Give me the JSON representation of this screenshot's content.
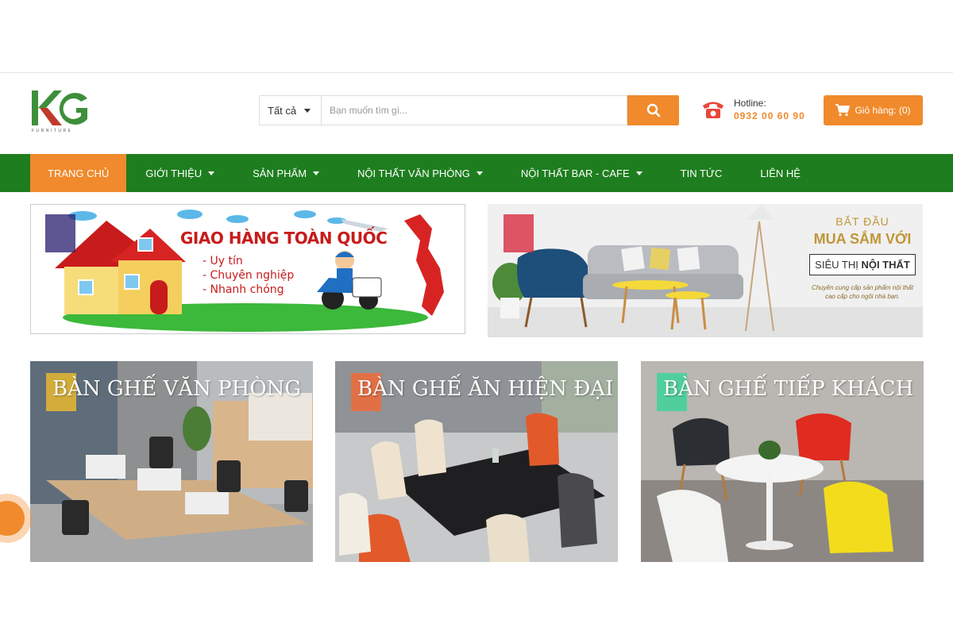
{
  "header": {
    "logo_text": "KG",
    "logo_tagline": "FURNITURE",
    "search": {
      "category": "Tất cả",
      "placeholder": "Bạn muốn tìm gì...",
      "button_icon": "search-icon"
    },
    "hotline": {
      "label": "Hotline:",
      "number": "0932 00 60 90"
    },
    "cart_label": "Giỏ hàng: (0)"
  },
  "nav": {
    "items": [
      {
        "label": "TRANG CHỦ",
        "active": true,
        "dropdown": false
      },
      {
        "label": "GIỚI THIỆU",
        "active": false,
        "dropdown": true
      },
      {
        "label": "SẢN PHẨM",
        "active": false,
        "dropdown": true
      },
      {
        "label": "NỘI THẤT VĂN PHÒNG",
        "active": false,
        "dropdown": true
      },
      {
        "label": "NỘI THẤT BAR - CAFE",
        "active": false,
        "dropdown": true
      },
      {
        "label": "TIN TỨC",
        "active": false,
        "dropdown": false
      },
      {
        "label": "LIÊN HỆ",
        "active": false,
        "dropdown": false
      }
    ]
  },
  "banners": {
    "left": {
      "title": "GIAO HÀNG TOÀN QUỐC",
      "items": [
        "- Uy tín",
        "- Chuyên nghiệp",
        "- Nhanh chóng"
      ]
    },
    "right": {
      "line1": "BẮT ĐẦU",
      "line2": "MUA SẮM VỚI",
      "box_pre": "SIÊU THỊ ",
      "box_bold": "NỘI THẤT",
      "small1": "Chuyên cung cấp sản phẩm nội thất",
      "small2": "cao cấp cho ngôi nhà bạn."
    }
  },
  "categories": [
    {
      "title": "BÀN GHẾ VĂN PHÒNG",
      "accent": "#e8b830"
    },
    {
      "title": "BÀN GHẾ ĂN HIỆN ĐẠI",
      "accent": "#f06a3a"
    },
    {
      "title": "BÀN GHẾ TIẾP KHÁCH",
      "accent": "#3dd39a"
    }
  ],
  "colors": {
    "brand_orange": "#f08a2c",
    "nav_green": "#1e7e1f",
    "logo_green": "#3e8f3a",
    "logo_red": "#c0392b"
  }
}
